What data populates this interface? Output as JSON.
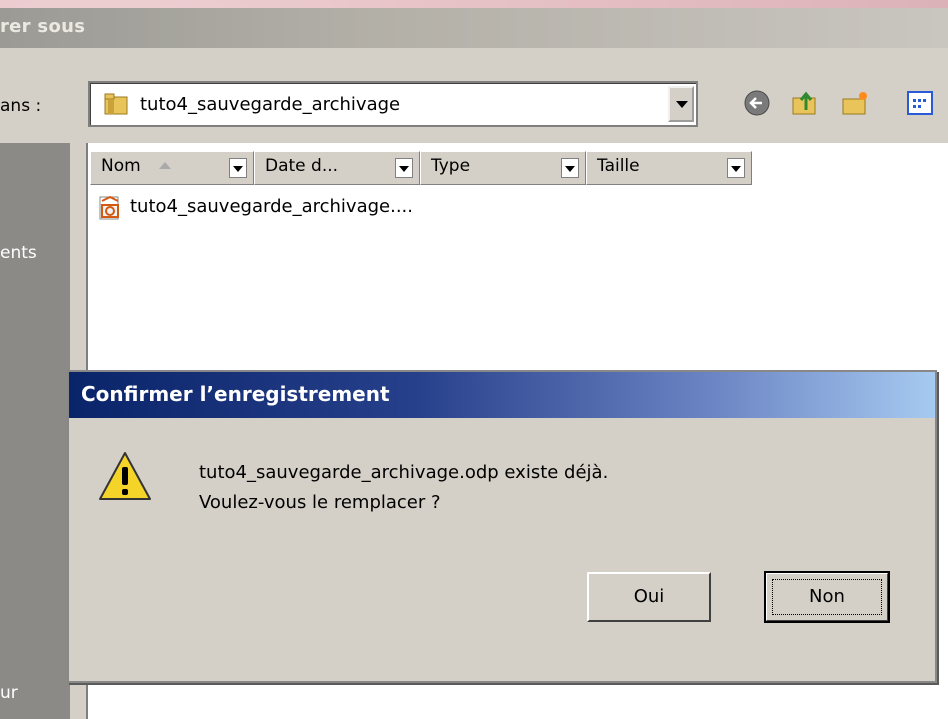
{
  "window": {
    "title": "rer sous",
    "look_in_label": "ans :",
    "current_folder": "tuto4_sauvegarde_archivage",
    "toolbar_icons": [
      "back-icon",
      "up-folder-icon",
      "new-folder-icon",
      "view-menu-icon"
    ]
  },
  "places_bar": {
    "items": [
      {
        "label": "ents"
      },
      {
        "label": "ur"
      }
    ]
  },
  "file_list": {
    "columns": [
      {
        "label": "Nom"
      },
      {
        "label": "Date d..."
      },
      {
        "label": "Type"
      },
      {
        "label": "Taille"
      }
    ],
    "files": [
      {
        "name": "tuto4_sauvegarde_archivage....",
        "icon": "openoffice-impress-file-icon"
      }
    ]
  },
  "dialog": {
    "title": "Confirmer l’enregistrement",
    "message_line1": "tuto4_sauvegarde_archivage.odp existe déjà.",
    "message_line2": "Voulez-vous le remplacer ?",
    "icon": "warning-icon",
    "yes_label": "Oui",
    "no_label": "Non"
  },
  "colors": {
    "dialog_title_start": "#0a246a",
    "dialog_title_end": "#a6caf0",
    "window_face": "#d4d0c8",
    "background": "#e9c9cc"
  }
}
